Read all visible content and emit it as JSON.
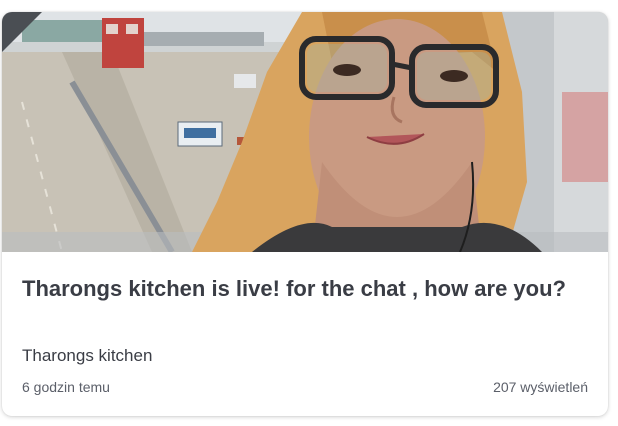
{
  "card": {
    "thumbnail": {
      "subject": "selfie of a woman with long blonde hair and black-framed glasses at an airport window",
      "background": "airport apron with red service building, white vehicles and runway markings"
    },
    "title": "Tharongs kitchen is live! for the chat , how are you?",
    "channel": "Tharongs kitchen",
    "time_ago": "6 godzin temu",
    "views": "207 wyświetleń"
  },
  "colors": {
    "title_text": "#3a3d45",
    "meta_text": "#5b5f69",
    "card_bg": "#ffffff"
  }
}
